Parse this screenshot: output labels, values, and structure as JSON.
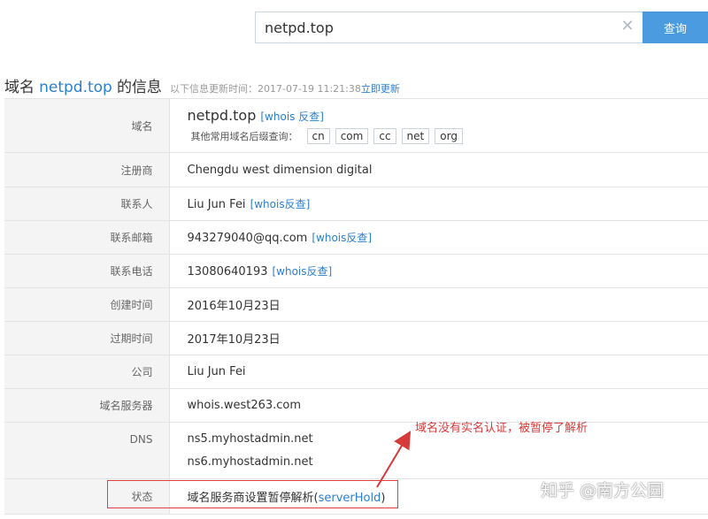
{
  "search": {
    "value": "netpd.top",
    "button_label": "查询",
    "clear_icon": "close-icon"
  },
  "heading": {
    "prefix": "域名",
    "domain": "netpd.top",
    "suffix": "的信息",
    "update_text": "以下信息更新时间：2017-07-19 11:21:38",
    "update_link": "立即更新"
  },
  "rows": {
    "domain": {
      "label": "域名",
      "value": "netpd.top",
      "link": "[whois 反查]",
      "suffix_label": "其他常用域名后缀查询：",
      "suffixes": [
        "cn",
        "com",
        "cc",
        "net",
        "org"
      ]
    },
    "registrar": {
      "label": "注册商",
      "value": "Chengdu west dimension digital"
    },
    "contact": {
      "label": "联系人",
      "value": "Liu Jun Fei",
      "link": "[whois反查]"
    },
    "email": {
      "label": "联系邮箱",
      "value": "943279040@qq.com",
      "link": "[whois反查]"
    },
    "phone": {
      "label": "联系电话",
      "value": "13080640193",
      "link": "[whois反查]"
    },
    "created": {
      "label": "创建时间",
      "value": "2016年10月23日"
    },
    "expires": {
      "label": "过期时间",
      "value": "2017年10月23日"
    },
    "company": {
      "label": "公司",
      "value": "Liu Jun Fei"
    },
    "whois_server": {
      "label": "域名服务器",
      "value": "whois.west263.com"
    },
    "dns": {
      "label": "DNS",
      "values": [
        "ns5.myhostadmin.net",
        "ns6.myhostadmin.net"
      ]
    },
    "status": {
      "label": "状态",
      "value_prefix": "域名服务商设置暂停解析(",
      "value_code": "serverHold",
      "value_suffix": ")"
    }
  },
  "annotation": {
    "text": "域名没有实名认证，被暂停了解析",
    "color": "#d63a3a"
  },
  "watermark": "知乎 @南方公园",
  "colors": {
    "accent": "#4a9be0",
    "link": "#2b7fcf",
    "label_bg": "#f4f4f4"
  }
}
